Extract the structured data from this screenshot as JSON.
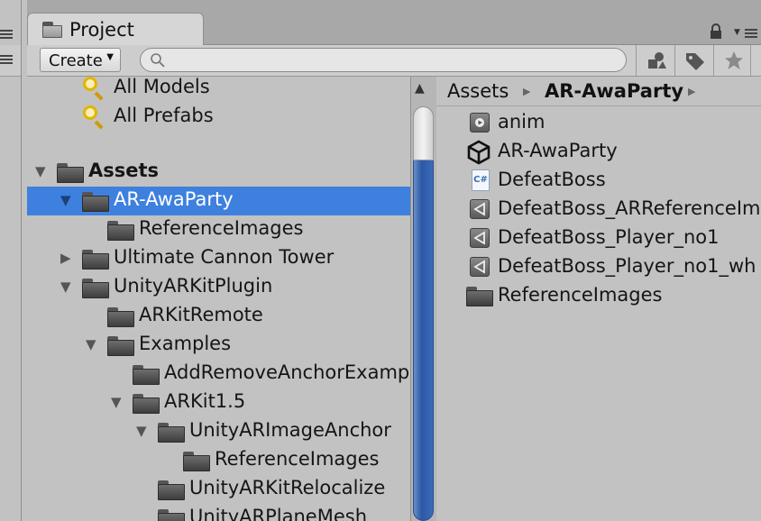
{
  "window": {
    "tab_title": "Project",
    "icons": [
      "folder-icon",
      "lock-icon",
      "panel-menu-icon"
    ]
  },
  "toolbar": {
    "create_label": "Create",
    "search_placeholder": "",
    "buttons": [
      "filter-by-type-icon",
      "filter-by-label-icon",
      "favorites-star-icon"
    ]
  },
  "tree": {
    "favorites": [
      {
        "label": "All Models"
      },
      {
        "label": "All Prefabs"
      }
    ],
    "items": [
      {
        "label": "Assets",
        "expanded": true
      },
      {
        "label": "AR-AwaParty",
        "expanded": true,
        "selected": true
      },
      {
        "label": "ReferenceImages"
      },
      {
        "label": "Ultimate Cannon Tower",
        "expanded": false
      },
      {
        "label": "UnityARKitPlugin",
        "expanded": true
      },
      {
        "label": "ARKitRemote"
      },
      {
        "label": "Examples",
        "expanded": true
      },
      {
        "label": "AddRemoveAnchorExamp"
      },
      {
        "label": "ARKit1.5",
        "expanded": true
      },
      {
        "label": "UnityARImageAnchor",
        "expanded": true
      },
      {
        "label": "ReferenceImages"
      },
      {
        "label": "UnityARKitRelocalize"
      },
      {
        "label": "UnityARPlaneMesh"
      }
    ]
  },
  "breadcrumb": {
    "root": "Assets",
    "current": "AR-AwaParty"
  },
  "files": [
    {
      "label": "anim",
      "icon": "animation-clip-icon"
    },
    {
      "label": "AR-AwaParty",
      "icon": "unity-scene-icon"
    },
    {
      "label": "DefeatBoss",
      "icon": "csharp-script-icon"
    },
    {
      "label": "DefeatBoss_ARReferenceIm",
      "icon": "unity-asset-icon"
    },
    {
      "label": "DefeatBoss_Player_no1",
      "icon": "unity-asset-icon"
    },
    {
      "label": "DefeatBoss_Player_no1_wh",
      "icon": "unity-asset-icon"
    },
    {
      "label": "ReferenceImages",
      "icon": "folder-icon"
    }
  ]
}
